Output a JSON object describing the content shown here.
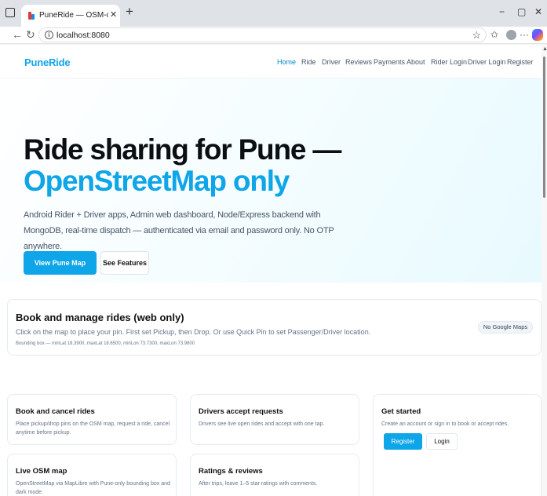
{
  "browser": {
    "tab_title": "PuneRide — OSM-only Ride Shar",
    "tab_close": "✕",
    "new_tab": "+",
    "url": "localhost:8080",
    "window_controls": {
      "minimize": "−",
      "maximize": "▢",
      "close": "✕"
    },
    "toolbar_more": "···"
  },
  "site": {
    "brand": "PuneRide",
    "nav": [
      "Home",
      "Ride",
      "Driver",
      "Reviews",
      "Payments",
      "About",
      "Rider Login",
      "Driver Login",
      "Register"
    ],
    "active_nav": "Home",
    "accent_color": "#0ea5e9"
  },
  "hero": {
    "title_line1": "Ride sharing for Pune —",
    "title_line2": "OpenStreetMap only",
    "subtitle": "Android Rider + Driver apps, Admin web dashboard, Node/Express backend with MongoDB, real-time dispatch — authenticated via email and password only. No OTP anywhere.",
    "primary_button": "View Pune Map (OSM)",
    "secondary_button": "See Features"
  },
  "booking": {
    "title": "Book and manage rides (web only)",
    "description": "Click on the map to place your pin. First set Pickup, then Drop. Or use Quick Pin to set Passenger/Driver location.",
    "bounding_box": "Bounding box — minLat 18.3900, maxLat 18.6500, minLon 73.7300, maxLon 73.9800",
    "badge": "No Google Maps"
  },
  "features": [
    {
      "title": "Book and cancel rides",
      "description": "Place pickup/drop pins on the OSM map, request a ride, cancel anytime before pickup."
    },
    {
      "title": "Drivers accept requests",
      "description": "Drivers see live open rides and accept with one tap."
    },
    {
      "title": "Live OSM map",
      "description": "OpenStreetMap via MapLibre with Pune-only bounding box and dark mode."
    },
    {
      "title": "Ratings & reviews",
      "description": "After trips, leave 1–5 star ratings with comments."
    }
  ],
  "get_started": {
    "title": "Get started",
    "description": "Create an account or sign in to book or accept rides.",
    "register_button": "Register",
    "login_button": "Login"
  }
}
